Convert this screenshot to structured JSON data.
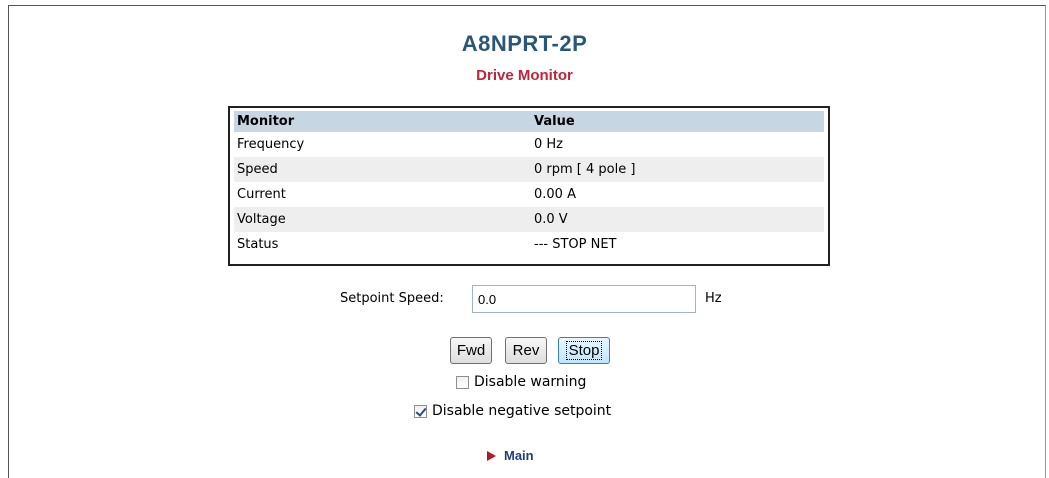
{
  "header": {
    "device_name": "A8NPRT-2P",
    "page_title": "Drive Monitor"
  },
  "monitor_table": {
    "headers": [
      "Monitor",
      "Value"
    ],
    "rows": [
      {
        "label": "Frequency",
        "value": "0 Hz"
      },
      {
        "label": "Speed",
        "value": "0 rpm [ 4 pole ]"
      },
      {
        "label": "Current",
        "value": "0.00 A"
      },
      {
        "label": "Voltage",
        "value": "0.0 V"
      },
      {
        "label": "Status",
        "value": "--- STOP NET"
      }
    ]
  },
  "setpoint": {
    "label": "Setpoint Speed:",
    "value": "0.0",
    "unit": "Hz"
  },
  "buttons": {
    "fwd": "Fwd",
    "rev": "Rev",
    "stop": "Stop"
  },
  "options": {
    "disable_warning": {
      "label": "Disable warning",
      "checked": false
    },
    "disable_negative": {
      "label": "Disable negative setpoint",
      "checked": true
    }
  },
  "nav": {
    "main_link": "Main",
    "main_icon": "triangle-right-icon",
    "arrow_color": "#b3182d"
  },
  "colors": {
    "title": "#2a5778",
    "subtitle": "#c0243a",
    "table_header_bg": "#c6d6e3"
  }
}
